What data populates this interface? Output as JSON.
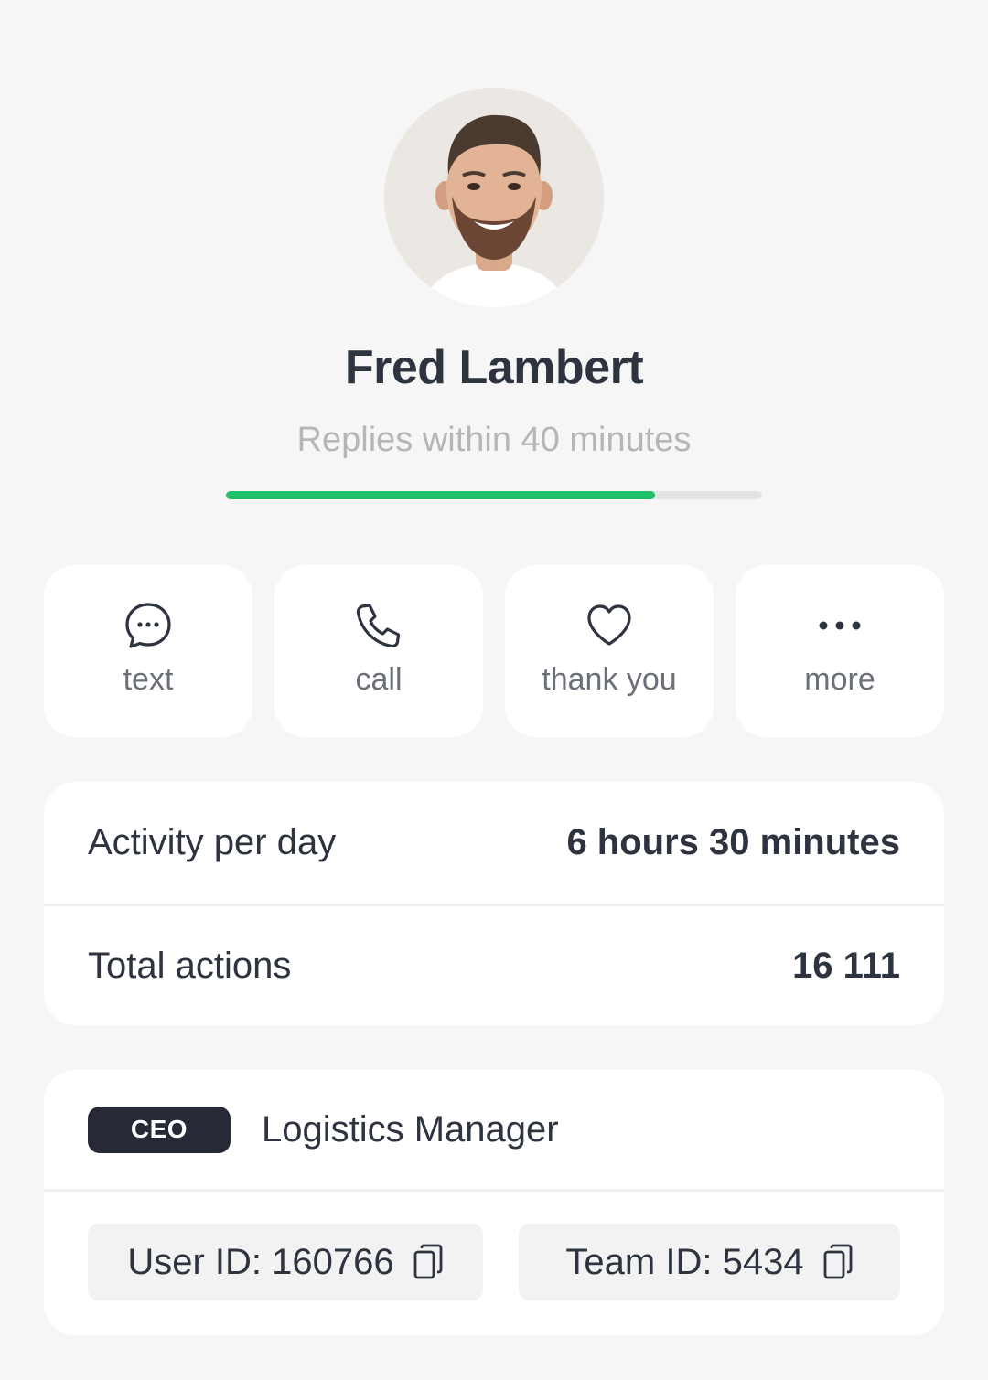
{
  "profile": {
    "name": "Fred Lambert",
    "replies": "Replies within 40 minutes",
    "reply_progress_percent": 80
  },
  "actions": [
    {
      "label": "text",
      "icon": "chat-bubble-icon"
    },
    {
      "label": "call",
      "icon": "phone-icon"
    },
    {
      "label": "thank you",
      "icon": "heart-icon"
    },
    {
      "label": "more",
      "icon": "more-dots-icon"
    }
  ],
  "stats": [
    {
      "label": "Activity per day",
      "value": "6 hours 30 minutes"
    },
    {
      "label": "Total actions",
      "value": "16 111"
    }
  ],
  "role": {
    "badge": "CEO",
    "title": "Logistics Manager"
  },
  "ids": {
    "user": "User ID: 160766",
    "team": "Team ID: 5434"
  },
  "colors": {
    "background": "#f6f6f6",
    "progress": "#1dc26a",
    "badge": "#262a37",
    "text": "#2d3440",
    "muted": "#b4b6b9"
  }
}
